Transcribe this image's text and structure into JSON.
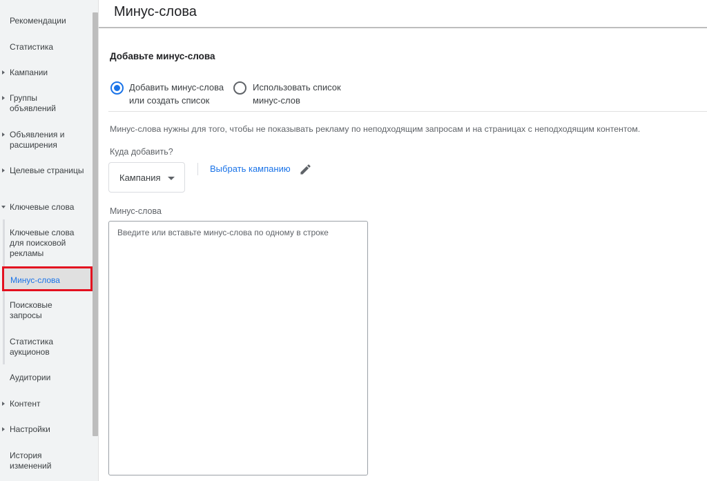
{
  "sidebar": {
    "items": [
      {
        "label": "Рекомендации"
      },
      {
        "label": "Статистика"
      },
      {
        "label": "Кампании"
      },
      {
        "label": "Группы объявлений"
      },
      {
        "label": "Объявления и расширения"
      },
      {
        "label": "Целевые страницы"
      },
      {
        "label": "Ключевые слова"
      },
      {
        "label": "Ключевые слова для поисковой рекламы"
      },
      {
        "label": "Минус-слова"
      },
      {
        "label": "Поисковые запросы"
      },
      {
        "label": "Статистика аукционов"
      },
      {
        "label": "Аудитории"
      },
      {
        "label": "Контент"
      },
      {
        "label": "Настройки"
      },
      {
        "label": "История изменений"
      }
    ]
  },
  "header": {
    "title": "Минус-слова"
  },
  "form": {
    "section_title": "Добавьте минус-слова",
    "radio_options": [
      {
        "label": "Добавить минус-слова или создать список",
        "checked": true
      },
      {
        "label": "Использовать список минус-слов",
        "checked": false
      }
    ],
    "description": "Минус-слова нужны для того, чтобы не показывать рекламу по неподходящим запросам и на страницах с неподходящим контентом.",
    "target_label": "Куда добавить?",
    "target_value": "Кампания",
    "choose_campaign_link": "Выбрать кампанию",
    "keywords_label": "Минус-слова",
    "keywords_placeholder": "Введите или вставьте минус-слова по одному в строке"
  },
  "colors": {
    "accent": "#1a73e8",
    "highlight_border": "#e3101f",
    "sidebar_bg": "#f1f3f4"
  }
}
